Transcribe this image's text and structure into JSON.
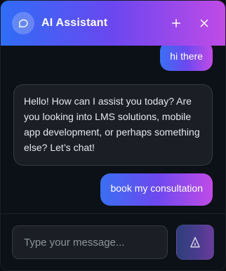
{
  "header": {
    "title": "AI Assistant",
    "icons": {
      "logo": "chat-bubble-icon",
      "add": "plus-icon",
      "close": "close-icon"
    },
    "colors": {
      "gradient": [
        "#2f6df6",
        "#6b47f0",
        "#c04be6"
      ]
    }
  },
  "conversation": [
    {
      "role": "user",
      "text": "hi there"
    },
    {
      "role": "assistant",
      "text": "Hello! How can I assist you today? Are you looking into LMS solutions, mobile app development, or perhaps something else? Let’s chat!"
    },
    {
      "role": "user",
      "text": "book my consultation"
    }
  ],
  "composer": {
    "placeholder": "Type your message...",
    "send_icon": "send-icon"
  }
}
